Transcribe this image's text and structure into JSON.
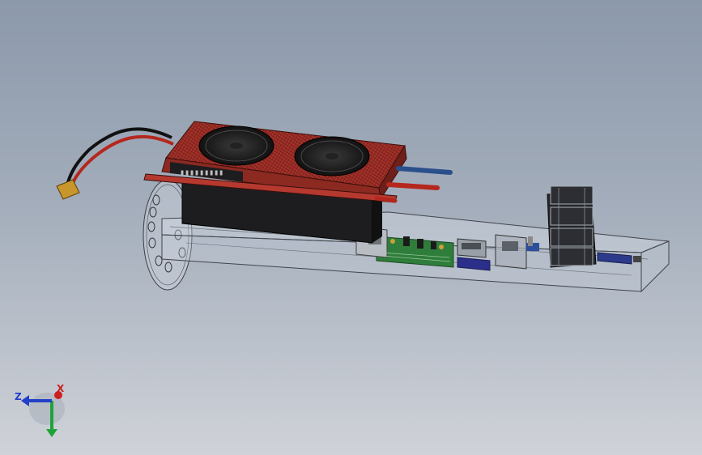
{
  "viewport": {
    "background_top": "#8c99ab",
    "background_bottom": "#cfd2d8"
  },
  "model": {
    "parts": [
      "clear-acrylic-base-tray",
      "round-clear-mount-plate",
      "red-heatsink-esc",
      "twin-cooling-fans",
      "xt-connector-power-lead",
      "blue-motor-wire",
      "red-motor-wire",
      "green-circuit-board",
      "usb-port",
      "stacked-ethernet-connectors",
      "blue-connector-plug"
    ],
    "colors": {
      "heatsink": "#a8322a",
      "heatsink_dark": "#5a1a16",
      "esc_body": "#1d1d1f",
      "pcb": "#2f7d3b",
      "wire_blue": "#2a4f8a",
      "wire_red": "#b5271d",
      "xt_connector": "#c9962c"
    }
  },
  "triad": {
    "x_label": "X",
    "z_label": "Z",
    "x_color": "#cc2020",
    "y_color": "#1ea33a",
    "z_color": "#2340c8"
  }
}
